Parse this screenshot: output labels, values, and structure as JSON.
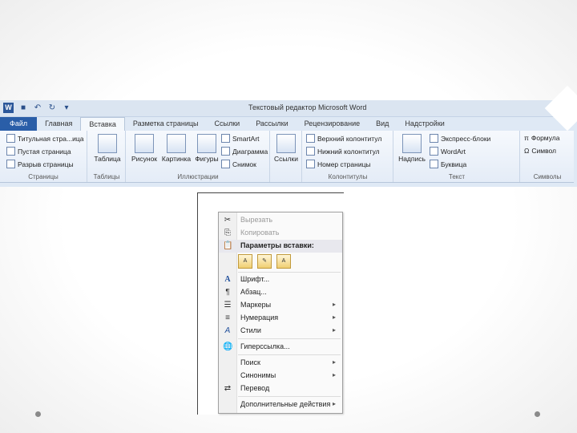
{
  "ribbon": {
    "window_title": "Текстовый редактор    Microsoft Word",
    "qat_icons": [
      "word-logo",
      "save-icon",
      "undo-icon",
      "redo-icon",
      "customize-icon"
    ],
    "tabs": [
      "Файл",
      "Главная",
      "Вставка",
      "Разметка страницы",
      "Ссылки",
      "Рассылки",
      "Рецензирование",
      "Вид",
      "Надстройки"
    ],
    "active_tab": "Вставка",
    "groups": {
      "pages": {
        "label": "Страницы",
        "items": [
          "Титульная стра...ица",
          "Пустая страница",
          "Разрыв страницы"
        ]
      },
      "tables": {
        "label": "Таблицы",
        "button": "Таблица"
      },
      "illustrations": {
        "label": "Иллюстрации",
        "buttons": [
          "Рисунок",
          "Картинка",
          "Фигуры"
        ],
        "items": [
          "SmartArt",
          "Диаграмма",
          "Снимок"
        ]
      },
      "links": {
        "label": "",
        "button": "Ссылки"
      },
      "header_footer": {
        "label": "Колонтитулы",
        "items": [
          "Верхний колонтитул",
          "Нижний колонтитул",
          "Номер страницы"
        ]
      },
      "text": {
        "label": "Текст",
        "button": "Надпись",
        "items": [
          "Экспресс-блоки",
          "WordArt",
          "Буквица"
        ]
      },
      "symbols": {
        "label": "Символы",
        "items": [
          "Формула",
          "Символ"
        ]
      }
    }
  },
  "context_menu": {
    "items": [
      {
        "label": "Вырезать",
        "icon": "cut-icon",
        "disabled": true
      },
      {
        "label": "Копировать",
        "icon": "copy-icon",
        "disabled": true
      },
      {
        "label": "Параметры вставки:",
        "icon": "paste-icon",
        "header": true
      },
      {
        "label": "Шрифт...",
        "icon": "font-icon"
      },
      {
        "label": "Абзац...",
        "icon": "paragraph-icon"
      },
      {
        "label": "Маркеры",
        "icon": "bullets-icon",
        "submenu": true
      },
      {
        "label": "Нумерация",
        "icon": "numbering-icon",
        "submenu": true
      },
      {
        "label": "Стили",
        "icon": "styles-icon",
        "submenu": true
      },
      {
        "label": "Гиперссылка...",
        "icon": "hyperlink-icon"
      },
      {
        "label": "Поиск",
        "icon": "",
        "submenu": true
      },
      {
        "label": "Синонимы",
        "icon": "",
        "submenu": true
      },
      {
        "label": "Перевод",
        "icon": "translate-icon"
      },
      {
        "label": "Дополнительные действия",
        "icon": "",
        "submenu": true
      }
    ],
    "paste_options": [
      "keep-source-formatting-icon",
      "merge-formatting-icon",
      "keep-text-only-icon"
    ]
  }
}
